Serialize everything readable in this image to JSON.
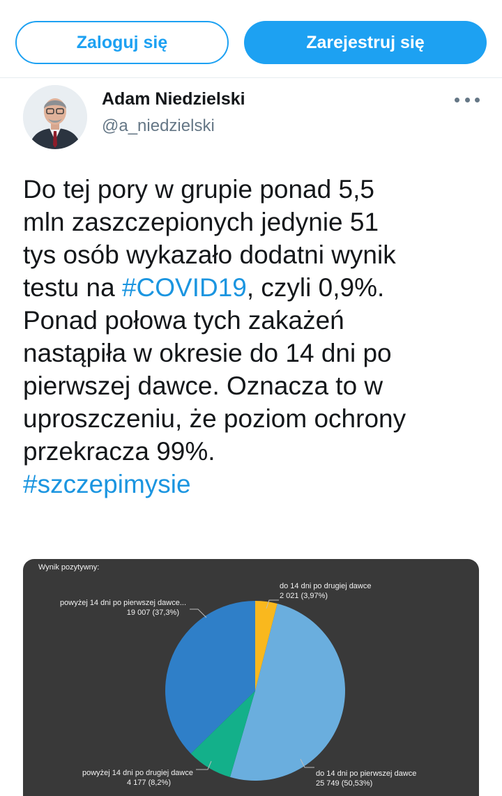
{
  "header": {
    "login_label": "Zaloguj się",
    "register_label": "Zarejestruj się"
  },
  "author": {
    "name": "Adam Niedzielski",
    "handle": "@a_niedzielski"
  },
  "tweet": {
    "lines": [
      [
        "Do tej pory w grupie ponad 5,5"
      ],
      [
        "mln zaszczepionych jedynie 51"
      ],
      [
        "tys osób wykazało dodatni wynik"
      ],
      [
        "testu na ",
        "#COVID19",
        ", czyli 0,9%."
      ],
      [
        "Ponad połowa tych zakażeń"
      ],
      [
        "nastąpiła w okresie do 14 dni po"
      ],
      [
        "pierwszej dawce. Oznacza to w"
      ],
      [
        "uproszczeniu, że poziom ochrony"
      ],
      [
        "przekracza 99%."
      ],
      [
        "#szczepimysie"
      ]
    ]
  },
  "colors": {
    "accent": "#1da1f2",
    "hashtag": "#1b95e0",
    "chart_background": "#393939"
  },
  "chart_data": {
    "type": "pie",
    "title": "Wynik pozytywny:",
    "start_angle_deg": 0,
    "direction": "clockwise",
    "slices": [
      {
        "label": "do 14 dni po drugiej dawce",
        "value_text": "2 021 (3,97%)",
        "value": 2021,
        "percent": 3.97,
        "color": "#f9b81e"
      },
      {
        "label": "do 14 dni po pierwszej dawce",
        "value_text": "25 749 (50,53%)",
        "value": 25749,
        "percent": 50.53,
        "color": "#6aaede"
      },
      {
        "label": "powyżej 14 dni po drugiej dawce",
        "value_text": "4 177 (8,2%)",
        "value": 4177,
        "percent": 8.2,
        "color": "#13b08a"
      },
      {
        "label": "powyżej 14 dni po pierwszej dawce...",
        "value_text": "19 007 (37,3%)",
        "value": 19007,
        "percent": 37.3,
        "color": "#2f7fc8"
      }
    ]
  }
}
